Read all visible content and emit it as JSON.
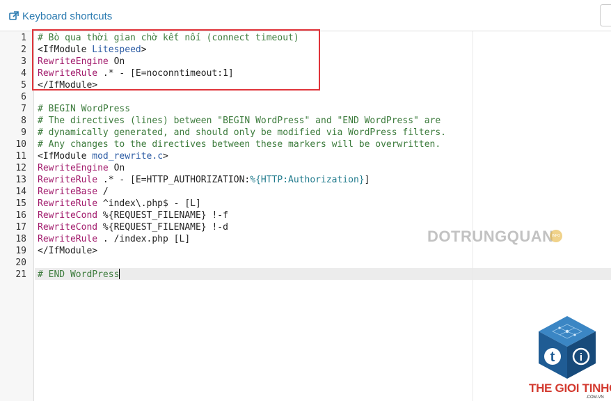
{
  "toolbar": {
    "shortcuts_label": "Keyboard shortcuts",
    "shortcuts_icon": "external-link-icon"
  },
  "editor": {
    "active_line": 21,
    "lines": [
      {
        "n": "1",
        "tokens": [
          {
            "t": "# Bò qua thời gian chờ kết nối (connect timeout)",
            "c": "comment"
          }
        ]
      },
      {
        "n": "2",
        "tokens": [
          {
            "t": "<IfModule ",
            "c": "tag"
          },
          {
            "t": "Litespeed",
            "c": "attr"
          },
          {
            "t": ">",
            "c": "tag"
          }
        ]
      },
      {
        "n": "3",
        "tokens": [
          {
            "t": "RewriteEngine",
            "c": "keyword"
          },
          {
            "t": " On",
            "c": "text"
          }
        ]
      },
      {
        "n": "4",
        "tokens": [
          {
            "t": "RewriteRule",
            "c": "keyword"
          },
          {
            "t": " .* - [E=noconntimeout:1]",
            "c": "text"
          }
        ]
      },
      {
        "n": "5",
        "tokens": [
          {
            "t": "</IfModule>",
            "c": "tag"
          }
        ]
      },
      {
        "n": "6",
        "tokens": []
      },
      {
        "n": "7",
        "tokens": [
          {
            "t": "# BEGIN WordPress",
            "c": "comment"
          }
        ]
      },
      {
        "n": "8",
        "tokens": [
          {
            "t": "# The directives (lines) between \"BEGIN WordPress\" and \"END WordPress\" are",
            "c": "comment"
          }
        ]
      },
      {
        "n": "9",
        "tokens": [
          {
            "t": "# dynamically generated, and should only be modified via WordPress filters.",
            "c": "comment"
          }
        ]
      },
      {
        "n": "10",
        "tokens": [
          {
            "t": "# Any changes to the directives between these markers will be overwritten.",
            "c": "comment"
          }
        ]
      },
      {
        "n": "11",
        "tokens": [
          {
            "t": "<IfModule ",
            "c": "tag"
          },
          {
            "t": "mod_rewrite.c",
            "c": "attr"
          },
          {
            "t": ">",
            "c": "tag"
          }
        ]
      },
      {
        "n": "12",
        "tokens": [
          {
            "t": "RewriteEngine",
            "c": "keyword"
          },
          {
            "t": " On",
            "c": "text"
          }
        ]
      },
      {
        "n": "13",
        "tokens": [
          {
            "t": "RewriteRule",
            "c": "keyword"
          },
          {
            "t": " .* - [E=HTTP_AUTHORIZATION:",
            "c": "text"
          },
          {
            "t": "%{HTTP:Authorization}",
            "c": "var"
          },
          {
            "t": "]",
            "c": "text"
          }
        ]
      },
      {
        "n": "14",
        "tokens": [
          {
            "t": "RewriteBase",
            "c": "keyword"
          },
          {
            "t": " /",
            "c": "text"
          }
        ]
      },
      {
        "n": "15",
        "tokens": [
          {
            "t": "RewriteRule",
            "c": "keyword"
          },
          {
            "t": " ^index\\.php$ - [L]",
            "c": "text"
          }
        ]
      },
      {
        "n": "16",
        "tokens": [
          {
            "t": "RewriteCond",
            "c": "keyword"
          },
          {
            "t": " %{REQUEST_FILENAME} !-f",
            "c": "text"
          }
        ]
      },
      {
        "n": "17",
        "tokens": [
          {
            "t": "RewriteCond",
            "c": "keyword"
          },
          {
            "t": " %{REQUEST_FILENAME} !-d",
            "c": "text"
          }
        ]
      },
      {
        "n": "18",
        "tokens": [
          {
            "t": "RewriteRule",
            "c": "keyword"
          },
          {
            "t": " . /index.php [L]",
            "c": "text"
          }
        ]
      },
      {
        "n": "19",
        "tokens": [
          {
            "t": "</IfModule>",
            "c": "tag"
          }
        ]
      },
      {
        "n": "20",
        "tokens": []
      },
      {
        "n": "21",
        "tokens": [
          {
            "t": "# END WordPress",
            "c": "comment"
          }
        ]
      }
    ]
  },
  "watermarks": {
    "site_text": "DOTRUNGQUAN",
    "site_badge": "INFO",
    "brand_name": "THE GIOI TINHOC",
    "brand_domain": ".COM.VN",
    "brand_icon": "tgt-cube-logo-icon"
  },
  "colors": {
    "highlight_border": "#e0343a",
    "link": "#2a7ab0",
    "comment": "#3c7b3c",
    "keyword": "#a1196b",
    "brand_red": "#d33a2f",
    "brand_blue": "#1f5c94"
  }
}
